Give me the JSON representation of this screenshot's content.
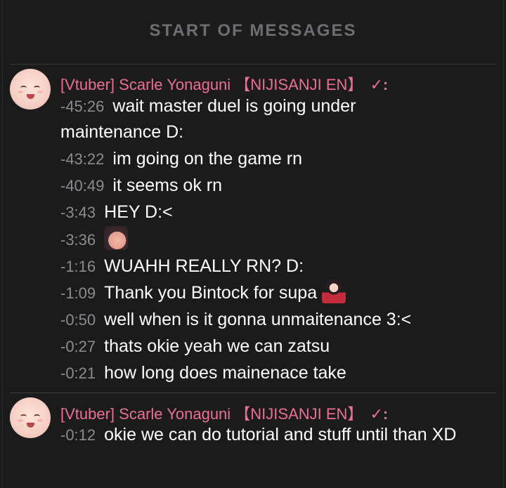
{
  "header": {
    "title": "START OF MESSAGES"
  },
  "groups": [
    {
      "author": "[Vtuber] Scarle Yonaguni 【NIJISANJI EN】",
      "badge": "✓:",
      "messages": [
        {
          "ts": "-45:26",
          "text": "wait master duel is going under maintenance D:"
        },
        {
          "ts": "-43:22",
          "text": "im going on the game rn"
        },
        {
          "ts": "-40:49",
          "text": "it seems ok rn"
        },
        {
          "ts": "-3:43",
          "text": "HEY D:<"
        },
        {
          "ts": "-3:36",
          "text": "",
          "emote": "face-emote"
        },
        {
          "ts": "-1:16",
          "text": "WUAHH REALLY RN? D:"
        },
        {
          "ts": "-1:09",
          "text": "Thank you Bintock for supa",
          "emote": "chibi-emote"
        },
        {
          "ts": "-0:50",
          "text": "well when is it gonna unmaitenance 3:<"
        },
        {
          "ts": "-0:27",
          "text": "thats okie yeah we can zatsu"
        },
        {
          "ts": "-0:21",
          "text": "how long does mainenace take"
        }
      ]
    },
    {
      "author": "[Vtuber] Scarle Yonaguni 【NIJISANJI EN】",
      "badge": "✓:",
      "messages": [
        {
          "ts": "-0:12",
          "text": "okie we can do tutorial and stuff until than XD"
        }
      ]
    }
  ],
  "colors": {
    "background": "#1b1b1c",
    "author": "#ec6f92",
    "timestamp": "#8c8c90",
    "header": "#6e6e72"
  }
}
